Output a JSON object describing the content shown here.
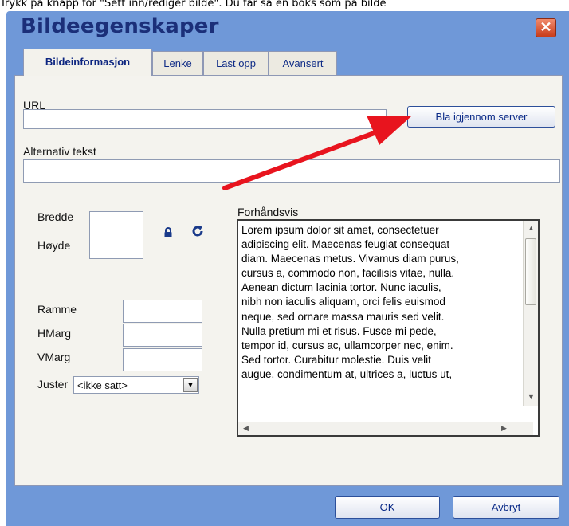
{
  "caption": "Trykk på knapp for \"Sett inn/rediger bilde\". Du får så en boks som på bilde",
  "dialog": {
    "title": "Bildeegenskaper",
    "close_glyph": "✕",
    "tabs": [
      {
        "label": "Bildeinformasjon",
        "active": true
      },
      {
        "label": "Lenke",
        "active": false
      },
      {
        "label": "Last opp",
        "active": false
      },
      {
        "label": "Avansert",
        "active": false
      }
    ]
  },
  "form": {
    "url_label": "URL",
    "url_value": "",
    "browse_button": "Bla igjennom server",
    "alt_label": "Alternativ tekst",
    "alt_value": "",
    "width_label": "Bredde",
    "width_value": "",
    "height_label": "Høyde",
    "height_value": "",
    "border_label": "Ramme",
    "border_value": "",
    "hspace_label": "HMarg",
    "hspace_value": "",
    "vspace_label": "VMarg",
    "vspace_value": "",
    "align_label": "Juster",
    "align_value": "<ikke satt>"
  },
  "preview": {
    "label": "Forhåndsvis",
    "lines": [
      "Lorem ipsum dolor sit amet, consectetuer",
      "adipiscing elit. Maecenas feugiat consequat",
      "diam. Maecenas metus. Vivamus diam purus,",
      "cursus a, commodo non, facilisis vitae, nulla.",
      "Aenean dictum lacinia tortor. Nunc iaculis,",
      "nibh non iaculis aliquam, orci felis euismod",
      "neque, sed ornare massa mauris sed velit.",
      "Nulla pretium mi et risus. Fusce mi pede,",
      "tempor id, cursus ac, ullamcorper nec, enim.",
      "Sed tortor. Curabitur molestie. Duis velit",
      "augue, condimentum at, ultrices a, luctus ut,"
    ]
  },
  "footer": {
    "ok_button": "OK",
    "cancel_button": "Avbryt"
  },
  "colors": {
    "dialog_blue": "#6f98d8",
    "title_navy": "#1b2f79",
    "arrow_red": "#e8141e"
  },
  "icons": {
    "lock": "lock-icon",
    "reset": "refresh-icon",
    "arrow": "red-arrow-annotation"
  }
}
